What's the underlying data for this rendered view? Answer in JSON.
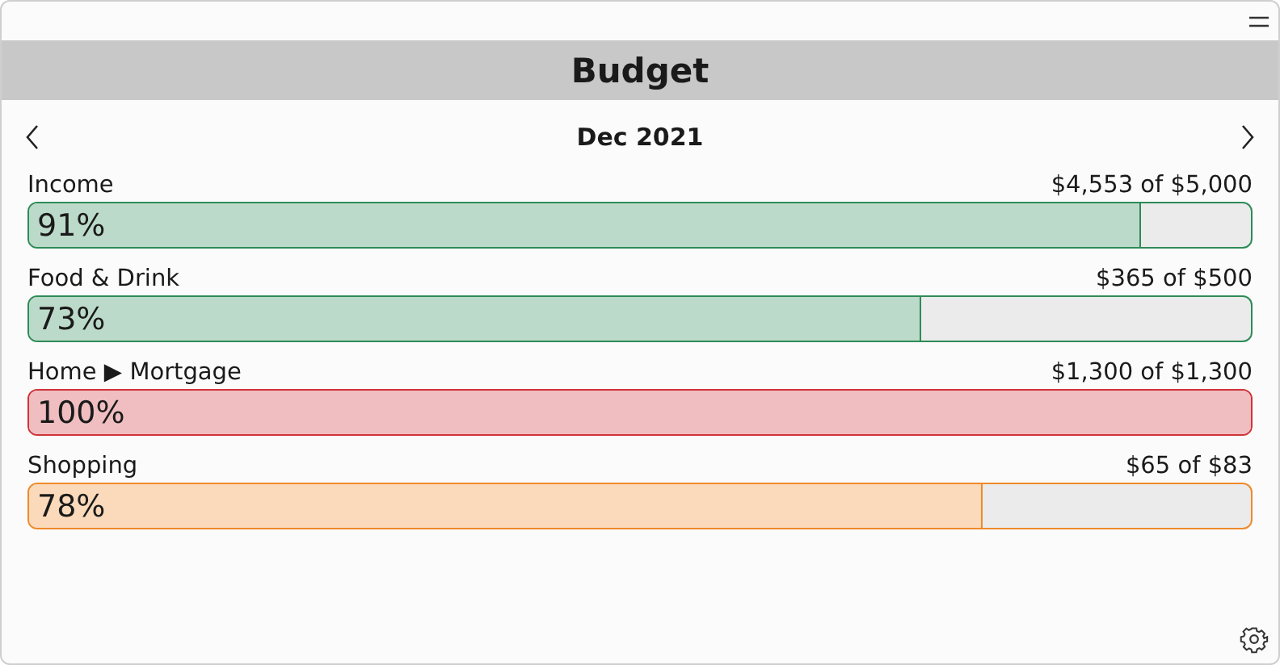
{
  "window": {
    "title": "Budget"
  },
  "period": {
    "label": "Dec 2021"
  },
  "budgets": [
    {
      "name": "Income",
      "amount": "$4,553 of $5,000",
      "percent": "91%",
      "level": 0.91,
      "color": "#2e8b57"
    },
    {
      "name": "Food & Drink",
      "amount": "$365 of $500",
      "percent": "73%",
      "level": 0.73,
      "color": "#2e8b57"
    },
    {
      "name": "Home ▶ Mortgage",
      "amount": "$1,300 of $1,300",
      "percent": "100%",
      "level": 1.0,
      "color": "#d0343a"
    },
    {
      "name": "Shopping",
      "amount": "$65 of $83",
      "percent": "78%",
      "level": 0.78,
      "color": "#ef8a2a"
    }
  ]
}
